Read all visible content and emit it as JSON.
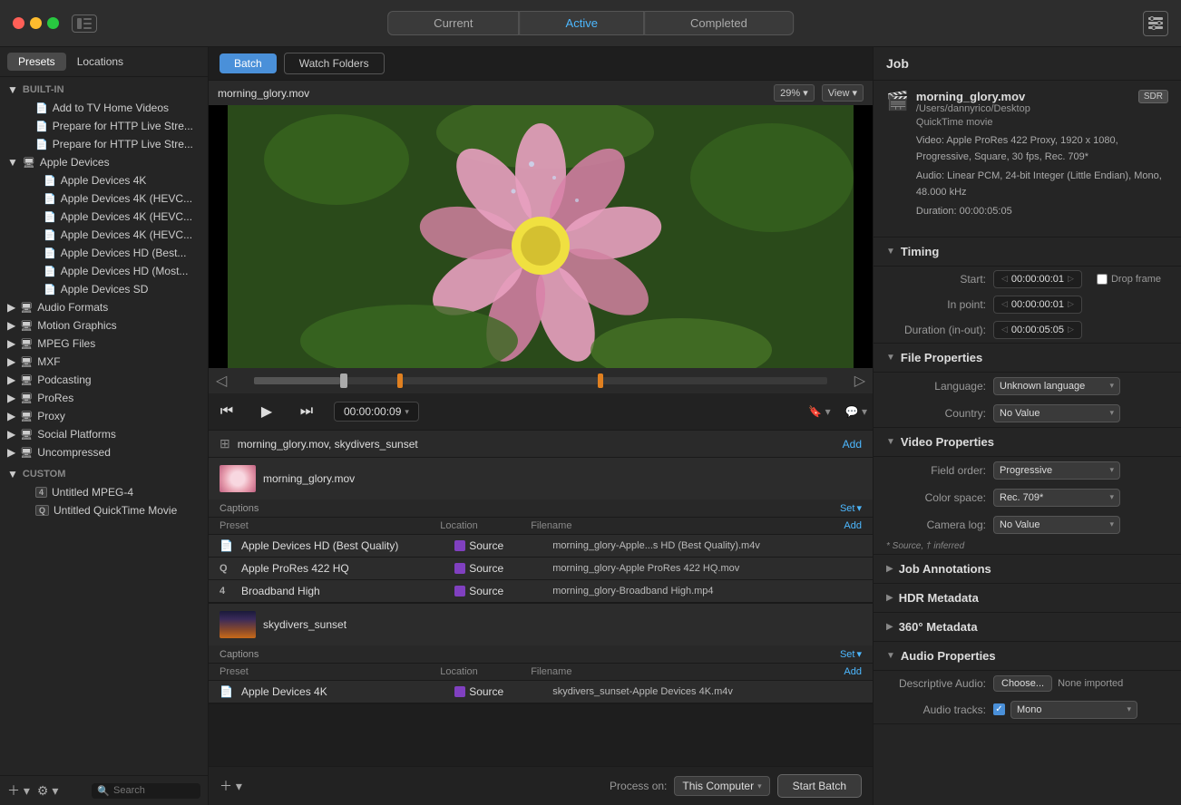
{
  "titlebar": {
    "tabs": [
      {
        "label": "Current",
        "active": false
      },
      {
        "label": "Active",
        "active": true
      },
      {
        "label": "Completed",
        "active": false
      }
    ]
  },
  "sidebar": {
    "tabs": [
      "Presets",
      "Locations"
    ],
    "active_tab": "Presets",
    "sections": {
      "built_in_label": "BUILT-IN",
      "custom_label": "CUSTOM"
    },
    "built_in_items": [
      {
        "label": "Add to TV Home Videos",
        "level": 1,
        "icon": "📄"
      },
      {
        "label": "Prepare for HTTP Live Stre...",
        "level": 1,
        "icon": "📄"
      },
      {
        "label": "Prepare for HTTP Live Stre...",
        "level": 1,
        "icon": "📄"
      },
      {
        "label": "Apple Devices",
        "level": 1,
        "icon": "🖥",
        "expanded": true
      },
      {
        "label": "Apple Devices 4K",
        "level": 2,
        "icon": "📄"
      },
      {
        "label": "Apple Devices 4K (HEVC...",
        "level": 2,
        "icon": "📄"
      },
      {
        "label": "Apple Devices 4K (HEVC...",
        "level": 2,
        "icon": "📄"
      },
      {
        "label": "Apple Devices 4K (HEVC...",
        "level": 2,
        "icon": "📄"
      },
      {
        "label": "Apple Devices HD (Best...",
        "level": 2,
        "icon": "📄"
      },
      {
        "label": "Apple Devices HD (Most...",
        "level": 2,
        "icon": "📄"
      },
      {
        "label": "Apple Devices SD",
        "level": 2,
        "icon": "📄"
      },
      {
        "label": "Audio Formats",
        "level": 1,
        "icon": "🖥"
      },
      {
        "label": "Motion Graphics",
        "level": 1,
        "icon": "🖥"
      },
      {
        "label": "MPEG Files",
        "level": 1,
        "icon": "🖥"
      },
      {
        "label": "MXF",
        "level": 1,
        "icon": "🖥"
      },
      {
        "label": "Podcasting",
        "level": 1,
        "icon": "🖥"
      },
      {
        "label": "ProRes",
        "level": 1,
        "icon": "🖥"
      },
      {
        "label": "Proxy",
        "level": 1,
        "icon": "🖥"
      },
      {
        "label": "Social Platforms",
        "level": 1,
        "icon": "🖥"
      },
      {
        "label": "Uncompressed",
        "level": 1,
        "icon": "🖥"
      }
    ],
    "custom_items": [
      {
        "label": "Untitled MPEG-4",
        "icon": "4"
      },
      {
        "label": "Untitled QuickTime Movie",
        "icon": "Q"
      }
    ],
    "search_placeholder": "Search"
  },
  "center": {
    "batch_label": "Batch",
    "watch_folders_label": "Watch Folders",
    "video_title": "morning_glory.mov",
    "zoom_level": "29%",
    "view_label": "View",
    "time_current": "00:00:00:09",
    "batch_header_title": "morning_glory.mov, skydivers_sunset",
    "add_label": "Add",
    "jobs": [
      {
        "name": "morning_glory.mov",
        "thumb_type": "flower",
        "captions_label": "Captions",
        "set_label": "Set",
        "preset_header": "Preset",
        "location_header": "Location",
        "filename_header": "Filename",
        "presets": [
          {
            "icon": "📄",
            "name": "Apple Devices HD (Best Quality)",
            "location": "Source",
            "filename": "morning_glory-Apple...s HD (Best Quality).m4v"
          },
          {
            "icon": "Q",
            "name": "Apple ProRes 422 HQ",
            "location": "Source",
            "filename": "morning_glory-Apple ProRes 422 HQ.mov"
          },
          {
            "icon": "4",
            "name": "Broadband High",
            "location": "Source",
            "filename": "morning_glory-Broadband High.mp4"
          }
        ]
      },
      {
        "name": "skydivers_sunset",
        "thumb_type": "sunset",
        "captions_label": "Captions",
        "set_label": "Set",
        "preset_header": "Preset",
        "location_header": "Location",
        "filename_header": "Filename",
        "presets": [
          {
            "icon": "📄",
            "name": "Apple Devices 4K",
            "location": "Source",
            "filename": "skydivers_sunset-Apple Devices 4K.m4v"
          }
        ]
      }
    ],
    "process_label": "Process on:",
    "process_value": "This Computer",
    "start_batch_label": "Start Batch"
  },
  "right_panel": {
    "title": "Job",
    "file": {
      "name": "morning_glory.mov",
      "badge": "SDR",
      "path": "/Users/dannyrico/Desktop",
      "type": "QuickTime movie",
      "video_info": "Video: Apple ProRes 422 Proxy, 1920 x 1080, Progressive, Square, 30 fps, Rec. 709*",
      "audio_info": "Audio: Linear PCM, 24-bit Integer (Little Endian), Mono, 48.000 kHz",
      "duration": "Duration: 00:00:05:05"
    },
    "timing": {
      "label": "Timing",
      "start_label": "Start:",
      "start_value": "00:00:00:01",
      "in_point_label": "In point:",
      "in_point_value": "00:00:00:01",
      "duration_label": "Duration (in-out):",
      "duration_value": "00:00:05:05",
      "drop_frame_label": "Drop frame"
    },
    "file_properties": {
      "label": "File Properties",
      "language_label": "Language:",
      "language_value": "Unknown language",
      "country_label": "Country:",
      "country_value": "No Value"
    },
    "video_properties": {
      "label": "Video Properties",
      "field_order_label": "Field order:",
      "field_order_value": "Progressive",
      "color_space_label": "Color space:",
      "color_space_value": "Rec. 709*",
      "camera_log_label": "Camera log:",
      "camera_log_value": "No Value",
      "source_note": "* Source, † inferred"
    },
    "job_annotations": {
      "label": "Job Annotations"
    },
    "hdr_metadata": {
      "label": "HDR Metadata"
    },
    "three_sixty_metadata": {
      "label": "360° Metadata"
    },
    "audio_properties": {
      "label": "Audio Properties",
      "descriptive_audio_label": "Descriptive Audio:",
      "choose_label": "Choose...",
      "none_imported_label": "None imported",
      "audio_tracks_label": "Audio tracks:",
      "audio_tracks_value": "Mono"
    }
  }
}
